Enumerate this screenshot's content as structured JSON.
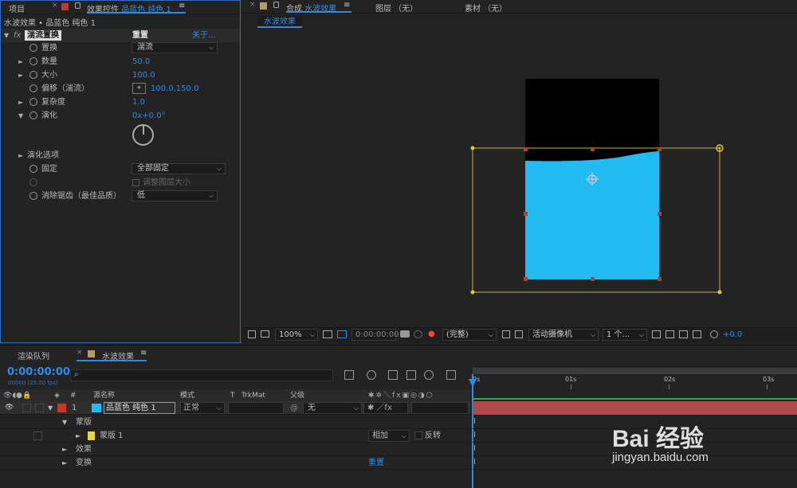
{
  "effects_panel": {
    "tab_project": "项目",
    "tab_effect_prefix": "效果控件",
    "tab_effect_layer": "品蓝色 纯色 1",
    "breadcrumb": "水波效果 • 品蓝色 纯色 1",
    "effect_name": "湍流置换",
    "reset": "重置",
    "about": "关于...",
    "props": {
      "displacement": {
        "label": "置换",
        "value": "湍流"
      },
      "amount": {
        "label": "数量",
        "value": "50.0"
      },
      "size": {
        "label": "大小",
        "value": "100.0"
      },
      "offset": {
        "label": "偏移（湍流）",
        "value": "100.0,150.0"
      },
      "complexity": {
        "label": "复杂度",
        "value": "1.0"
      },
      "evolution": {
        "label": "演化",
        "value": "0x+0.0°"
      },
      "evolution_options": {
        "label": "演化选项"
      },
      "pinning": {
        "label": "固定",
        "value": "全部固定"
      },
      "resize_layer": {
        "label": "调整图层大小"
      },
      "antialias": {
        "label": "消除锯齿（最佳品质）",
        "value": "低"
      }
    }
  },
  "composition_panel": {
    "tab_comp_prefix": "合成",
    "tab_comp_name": "水波效果",
    "tab_layer": "图层 （无）",
    "tab_footage": "素材 （无）",
    "subtab": "水波效果",
    "zoom": "100%",
    "timecode": "0:00:00:00",
    "resolution": "(完整)",
    "camera": "活动摄像机",
    "views": "1 个...",
    "exposure": "+0.0",
    "colors": {
      "water": "#22bcf2",
      "black_area": "#000000",
      "bbox": "#c9b33a",
      "handle": "#c0392b"
    }
  },
  "timeline": {
    "tab_render": "渲染队列",
    "tab_comp": "水波效果",
    "timecode": "0:00:00:00",
    "fps": "00000 (25.00 fps)",
    "search_placeholder": "",
    "col_number": "#",
    "col_source": "源名称",
    "col_mode": "模式",
    "col_t": "T",
    "col_trkmat": "TrkMat",
    "col_parent": "父级",
    "ruler": [
      "0s",
      "01s",
      "02s",
      "03s"
    ],
    "layer": {
      "number": "1",
      "name": "品蓝色 纯色 1",
      "mode": "正常",
      "parent": "无",
      "color": "#22bcf2"
    },
    "masks_group": "蒙版",
    "mask1": {
      "name": "蒙版 1",
      "mode": "相加",
      "invert": "反转"
    },
    "effects_group": "效果",
    "transform_group": "变换",
    "transform_reset": "重置"
  },
  "watermark": {
    "brand": "Bai 经验",
    "url": "jingyan.baidu.com"
  }
}
